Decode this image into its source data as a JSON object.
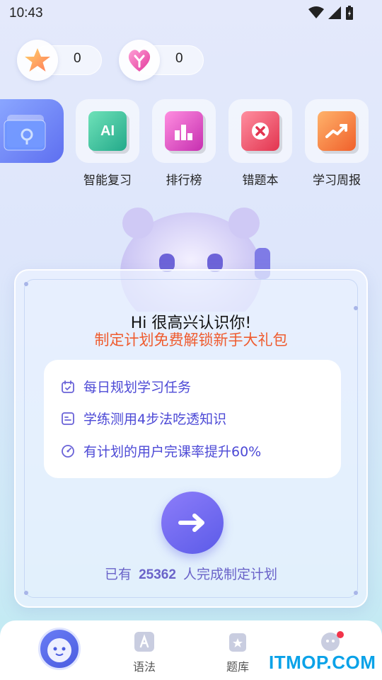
{
  "status_bar": {
    "time": "10:43"
  },
  "counters": [
    {
      "icon": "star-icon",
      "value": "0"
    },
    {
      "icon": "heart-icon",
      "value": "0"
    }
  ],
  "shortcuts": [
    {
      "label": "智能复习",
      "icon": "ai-book-icon",
      "badge": "AI",
      "color": "#3fc2a0"
    },
    {
      "label": "排行榜",
      "icon": "ranking-book-icon",
      "color": "#e84fc0"
    },
    {
      "label": "错题本",
      "icon": "mistake-book-icon",
      "color": "#f2576b"
    },
    {
      "label": "学习周报",
      "icon": "report-book-icon",
      "color": "#f5823a"
    }
  ],
  "plan_card": {
    "title": "Hi 很高兴认识你!",
    "subtitle": "制定计划免费解锁新手大礼包",
    "benefits": [
      {
        "icon": "calendar-icon",
        "text": "每日规划学习任务"
      },
      {
        "icon": "list-icon",
        "text": "学练测用4步法吃透知识"
      },
      {
        "icon": "target-icon",
        "text": "有计划的用户完课率提升60%"
      }
    ],
    "stat_prefix": "已有",
    "stat_count": "25362",
    "stat_suffix": "人完成制定计划"
  },
  "nav": {
    "items": [
      {
        "label": "",
        "icon": "mascot-avatar-icon"
      },
      {
        "label": "语法",
        "icon": "grammar-icon"
      },
      {
        "label": "题库",
        "icon": "question-bank-icon"
      },
      {
        "label": "",
        "icon": "message-icon"
      }
    ]
  },
  "watermark": "ITMOP.COM",
  "colors": {
    "accent": "#5b5be8",
    "highlight": "#ef5b2e",
    "benefit_text": "#4d4ad6"
  }
}
